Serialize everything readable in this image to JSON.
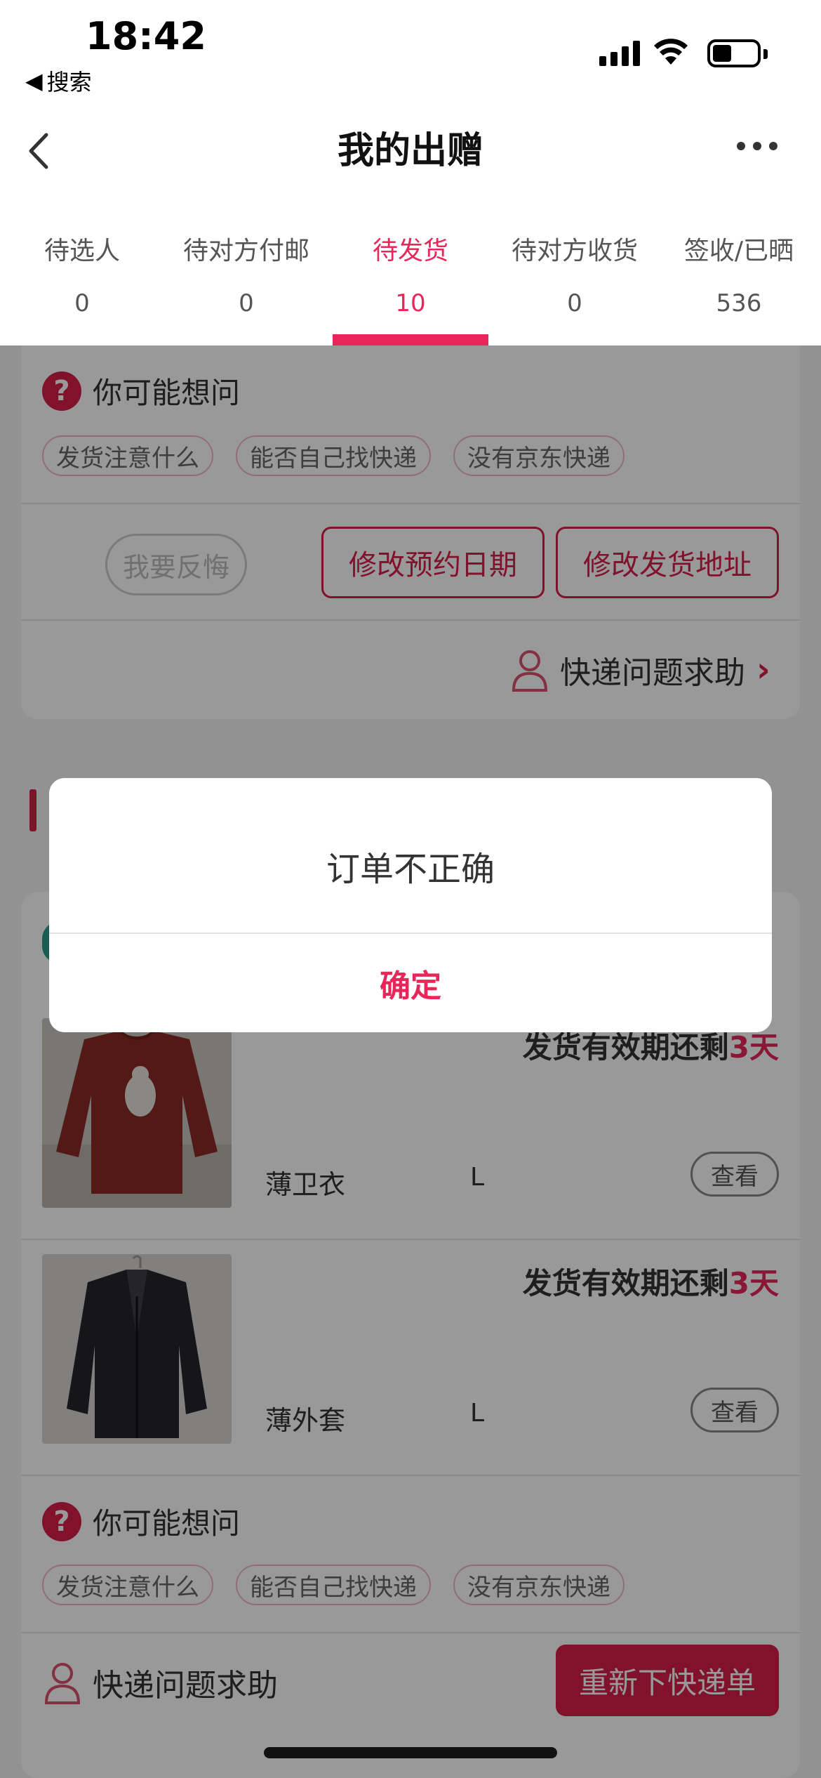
{
  "status_bar": {
    "time": "18:42",
    "back_app_label": "搜索",
    "back_app_arrow": "◀"
  },
  "nav": {
    "title": "我的出赠",
    "back_icon": "chevron-left-icon",
    "more_icon": "more-dots-icon"
  },
  "tabs": [
    {
      "label": "待选人",
      "count": "0"
    },
    {
      "label": "待对方付邮",
      "count": "0"
    },
    {
      "label": "待发货",
      "count": "10",
      "active": true
    },
    {
      "label": "待对方收货",
      "count": "0"
    },
    {
      "label": "签收/已晒",
      "count": "536"
    }
  ],
  "faq": {
    "icon_glyph": "?",
    "title": "你可能想问",
    "chips": [
      "发货注意什么",
      "能否自己找快递",
      "没有京东快递"
    ]
  },
  "actions": {
    "regret": "我要反悔",
    "change_date": "修改预约日期",
    "change_address": "修改发货地址",
    "reorder": "重新下快递单"
  },
  "help": {
    "label": "快递问题求助",
    "chevron": "›"
  },
  "items": [
    {
      "name": "薄卫衣",
      "size": "L",
      "deadline_prefix": "发货有效期还剩",
      "deadline_days": "3天",
      "view_label": "查看"
    },
    {
      "name": "薄外套",
      "size": "L",
      "deadline_prefix": "发货有效期还剩",
      "deadline_days": "3天",
      "view_label": "查看"
    }
  ],
  "dialog": {
    "message": "订单不正确",
    "confirm": "确定"
  },
  "colors": {
    "accent": "#e8265a",
    "button_red": "#d81e4a",
    "overlay": "rgba(0,0,0,0.40)"
  }
}
